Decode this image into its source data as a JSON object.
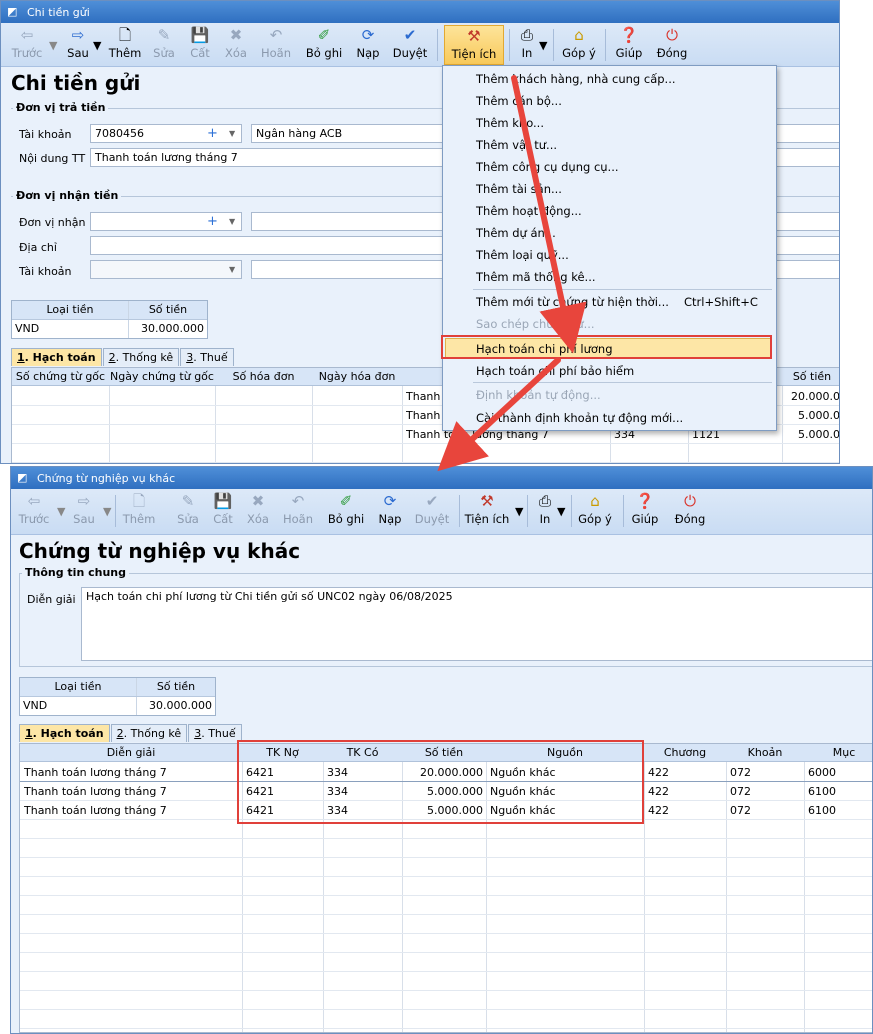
{
  "win1": {
    "title": "Chi tiền gửi",
    "toolbar": [
      "Trước",
      "Sau",
      "Thêm",
      "Sửa",
      "Cất",
      "Xóa",
      "Hoãn",
      "Bỏ ghi",
      "Nạp",
      "Duyệt",
      "Tiện ích",
      "In",
      "Góp ý",
      "Giúp",
      "Đóng"
    ],
    "heading": "Chi tiền gửi",
    "group_payer": "Đơn vị trả tiền",
    "lbl_account": "Tài khoản",
    "account_value": "7080456",
    "bank_value": "Ngân hàng ACB",
    "lbl_content": "Nội dung TT",
    "content_value": "Thanh toán lương tháng 7",
    "group_payee": "Đơn vị nhận tiền",
    "lbl_payee": "Đơn vị nhận",
    "lbl_address": "Địa chỉ",
    "lbl_payee_account": "Tài khoản",
    "currency_header": "Loại tiền",
    "amount_header": "Số tiền",
    "currency": "VND",
    "amount": "30.000.000",
    "tabs": [
      "Hạch toán",
      "Thống kê",
      "Thuế"
    ],
    "tab_keys": [
      "1",
      "2",
      "3"
    ],
    "grid_headers": [
      "Số chứng từ gốc",
      "Ngày chứng từ gốc",
      "Số hóa đơn",
      "Ngày hóa đơn",
      "Số tiền"
    ],
    "rows": [
      {
        "desc": "Thanh t",
        "debit": "",
        "credit": "",
        "amount": "20.000.0"
      },
      {
        "desc": "Thanh t",
        "debit": "",
        "credit": "",
        "amount": "5.000.0"
      },
      {
        "desc": "Thanh toán lương tháng 7",
        "debit": "334",
        "credit": "1121",
        "amount": "5.000.0"
      }
    ]
  },
  "menu": {
    "items": [
      "Thêm khách hàng, nhà cung cấp...",
      "Thêm cán bộ...",
      "Thêm kho...",
      "Thêm vật tư...",
      "Thêm công cụ dụng cụ...",
      "Thêm tài sản...",
      "Thêm hoạt động...",
      "Thêm dự án...",
      "Thêm loại quỹ...",
      "Thêm mã thống kê..."
    ],
    "new_from_current": "Thêm mới từ chứng từ hiện thời...",
    "new_from_current_shortcut": "Ctrl+Shift+C",
    "copy_voucher": "Sao chép chứng từ...",
    "salary_cost": "Hạch toán chi phí lương",
    "insurance_cost": "Hạch toán chi phí bảo hiểm",
    "auto_entry": "Định khoản tự động...",
    "install_auto": "Cài thành định khoản tự động mới..."
  },
  "win2": {
    "title": "Chứng từ nghiệp vụ khác",
    "toolbar": [
      "Trước",
      "Sau",
      "Thêm",
      "Sửa",
      "Cất",
      "Xóa",
      "Hoãn",
      "Bỏ ghi",
      "Nạp",
      "Duyệt",
      "Tiện ích",
      "In",
      "Góp ý",
      "Giúp",
      "Đóng"
    ],
    "heading": "Chứng từ nghiệp vụ khác",
    "group_general": "Thông tin chung",
    "lbl_description": "Diễn giải",
    "description": "Hạch toán chi phí lương từ Chi tiền gửi số UNC02 ngày 06/08/2025",
    "currency_header": "Loại tiền",
    "amount_header": "Số tiền",
    "currency": "VND",
    "amount": "30.000.000",
    "tabs": [
      "Hạch toán",
      "Thống kê",
      "Thuế"
    ],
    "tab_keys": [
      "1",
      "2",
      "3"
    ],
    "grid_headers": [
      "Diễn giải",
      "TK Nợ",
      "TK Có",
      "Số tiền",
      "Nguồn",
      "Chương",
      "Khoản",
      "Mục"
    ],
    "rows": [
      {
        "desc": "Thanh toán lương tháng 7",
        "debit": "6421",
        "credit": "334",
        "amount": "20.000.000",
        "source": "Nguồn khác",
        "chapter": "422",
        "item": "072",
        "section": "6000"
      },
      {
        "desc": "Thanh toán lương tháng 7",
        "debit": "6421",
        "credit": "334",
        "amount": "5.000.000",
        "source": "Nguồn khác",
        "chapter": "422",
        "item": "072",
        "section": "6100"
      },
      {
        "desc": "Thanh toán lương tháng 7",
        "debit": "6421",
        "credit": "334",
        "amount": "5.000.000",
        "source": "Nguồn khác",
        "chapter": "422",
        "item": "072",
        "section": "6100"
      }
    ]
  },
  "colors": {
    "accent_red": "#e0403a",
    "highlight": "#fde6a6",
    "window_bg": "#e9f1fb",
    "titlebar": "#3a7bd0"
  }
}
